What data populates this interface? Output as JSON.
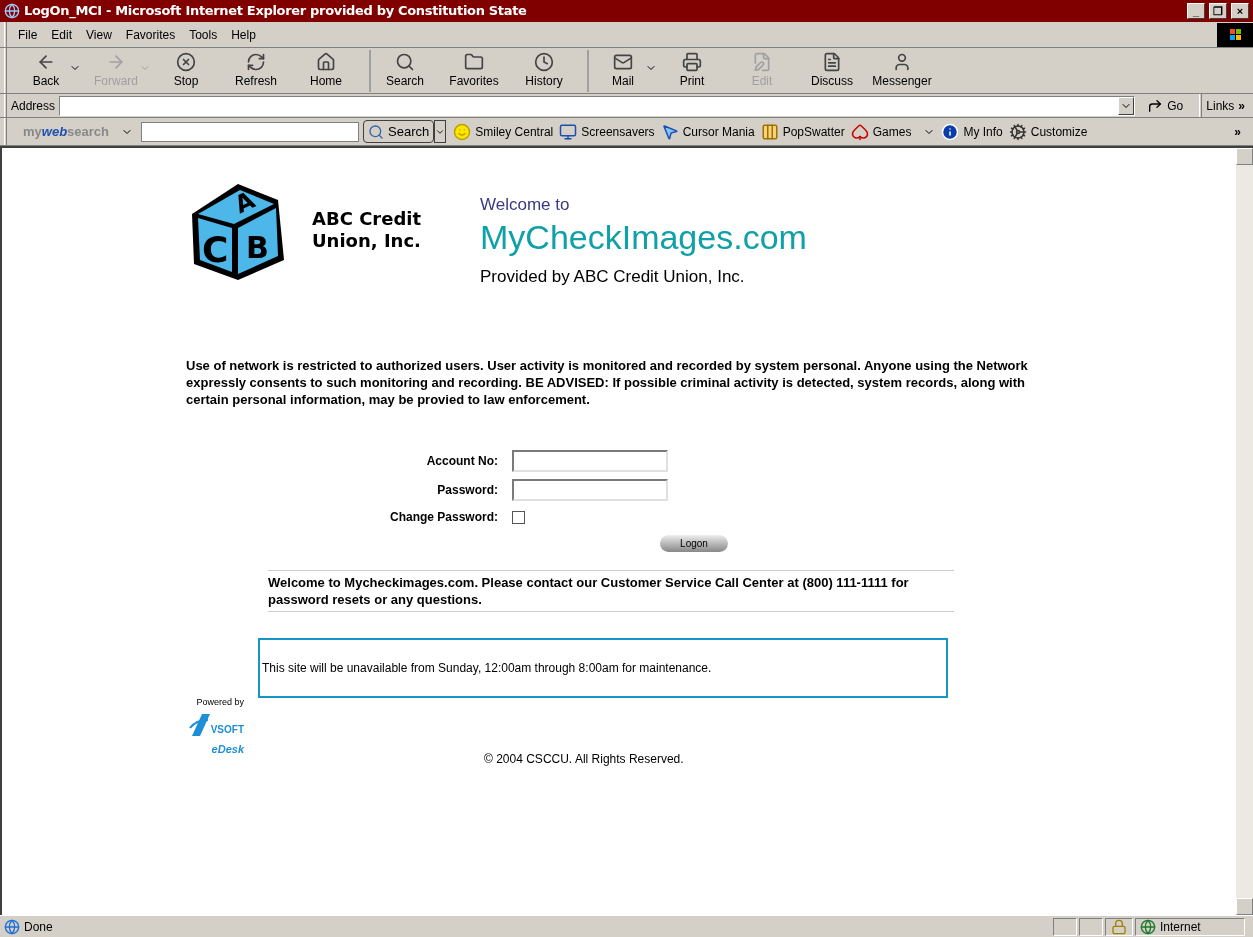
{
  "window": {
    "title": "LogOn_MCI - Microsoft Internet Explorer provided by Constitution State",
    "controls": [
      "_",
      "❐",
      "×"
    ]
  },
  "menu": [
    "File",
    "Edit",
    "View",
    "Favorites",
    "Tools",
    "Help"
  ],
  "toolbar": [
    {
      "label": "Back",
      "kind": "back",
      "disabled": false,
      "dropdown": true
    },
    {
      "label": "Forward",
      "kind": "forward",
      "disabled": true,
      "dropdown": true
    },
    {
      "label": "Stop",
      "kind": "stop",
      "disabled": false,
      "dropdown": false
    },
    {
      "label": "Refresh",
      "kind": "refresh",
      "disabled": false,
      "dropdown": false
    },
    {
      "label": "Home",
      "kind": "home",
      "disabled": false,
      "dropdown": false
    },
    {
      "label": "Search",
      "kind": "search",
      "disabled": false,
      "dropdown": false,
      "separator": true
    },
    {
      "label": "Favorites",
      "kind": "favorites",
      "disabled": false,
      "dropdown": false
    },
    {
      "label": "History",
      "kind": "history",
      "disabled": false,
      "dropdown": false
    },
    {
      "label": "Mail",
      "kind": "mail",
      "disabled": false,
      "dropdown": true,
      "separator": true
    },
    {
      "label": "Print",
      "kind": "print",
      "disabled": false,
      "dropdown": false
    },
    {
      "label": "Edit",
      "kind": "edit",
      "disabled": true,
      "dropdown": false
    },
    {
      "label": "Discuss",
      "kind": "discuss",
      "disabled": false,
      "dropdown": false
    },
    {
      "label": "Messenger",
      "kind": "messenger",
      "disabled": false,
      "dropdown": false
    }
  ],
  "address_bar": {
    "label": "Address",
    "go": "Go",
    "links": "Links",
    "links_more": "»"
  },
  "search_bar": {
    "brand_1": "my",
    "brand_2": "web",
    "brand_3": "search",
    "button": "Search",
    "more": "»",
    "links": [
      {
        "label": "Smiley Central",
        "kind": "smiley"
      },
      {
        "label": "Screensavers",
        "kind": "monitor"
      },
      {
        "label": "Cursor Mania",
        "kind": "cursor"
      },
      {
        "label": "PopSwatter",
        "kind": "swatter"
      },
      {
        "label": "Games",
        "kind": "games",
        "dropdown": true
      },
      {
        "label": "My Info",
        "kind": "info"
      },
      {
        "label": "Customize",
        "kind": "gear"
      }
    ]
  },
  "page": {
    "logo": {
      "name_line_1": "ABC Credit",
      "name_line_2": "Union, Inc.",
      "block_letters": [
        "A",
        "C",
        "B"
      ]
    },
    "welcome": "Welcome to",
    "site": "MyCheckImages.com",
    "provided_by": "Provided by ABC Credit Union, Inc.",
    "notice": "Use of network is restricted to authorized users. User activity is monitored and recorded by system personal. Anyone using the Network expressly consents to such monitoring and recording. BE ADVISED: If possible criminal activity is detected, system records, along with certain personal information, may be provied to law enforcement.",
    "form": {
      "fields": [
        {
          "label": "Account No:",
          "kind": "text"
        },
        {
          "label": "Password:",
          "kind": "password"
        },
        {
          "label": "Change Password:",
          "kind": "checkbox",
          "checked": false
        }
      ],
      "button": "Logon"
    },
    "contact": "Welcome to Mycheckimages.com. Please contact our Customer Service Call Center at (800) 111-1111 for password resets or any questions.",
    "maintenance": "This site will be unavailable from Sunday, 12:00am through 8:00am for maintenance.",
    "powered_by": "Powered by",
    "vendor": "VSOFT",
    "product": "eDesk",
    "copyright": "© 2004 CSCCU. All Rights Reserved."
  },
  "status_bar": {
    "text": "Done",
    "zone": "Internet"
  }
}
